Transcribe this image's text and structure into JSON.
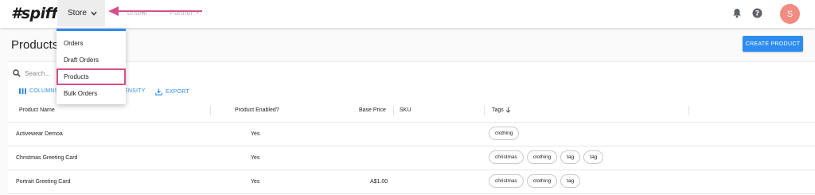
{
  "app": {
    "logo": "#spiff"
  },
  "nav": {
    "store_label": "Store",
    "faded_item_1": "ontent",
    "faded_item_2": "Partner"
  },
  "store_menu": {
    "items": [
      {
        "label": "Orders"
      },
      {
        "label": "Draft Orders"
      },
      {
        "label": "Products",
        "highlighted": true
      },
      {
        "label": "Bulk Orders"
      }
    ]
  },
  "user": {
    "avatar_initial": "S"
  },
  "page": {
    "title": "Products",
    "create_button": "CREATE PRODUCT"
  },
  "grid": {
    "search_placeholder": "Search...",
    "toolbar": {
      "columns": "COLUMNS",
      "density": "ENSITY",
      "export": "EXPORT"
    },
    "columns": {
      "name": "Product Name",
      "enabled": "Product Enabled?",
      "price": "Base Price",
      "sku": "SKU",
      "tags": "Tags",
      "tags_sort_icon": "arrow-down-icon"
    },
    "rows": [
      {
        "name": "Activewear Demoa",
        "enabled": "Yes",
        "price": "",
        "sku": "",
        "tags": [
          "clothing"
        ]
      },
      {
        "name": "Christmas Greeting Card",
        "enabled": "Yes",
        "price": "",
        "sku": "",
        "tags": [
          "christmas",
          "clothing",
          "tag",
          "tag"
        ]
      },
      {
        "name": "Portrait Greeting Card",
        "enabled": "Yes",
        "price": "A$1.00",
        "sku": "",
        "tags": [
          "christmas",
          "clothing",
          "tag"
        ]
      }
    ]
  },
  "colors": {
    "accent": "#2e8cf0",
    "highlight": "#d64f8a",
    "avatar": "#f28b82"
  }
}
